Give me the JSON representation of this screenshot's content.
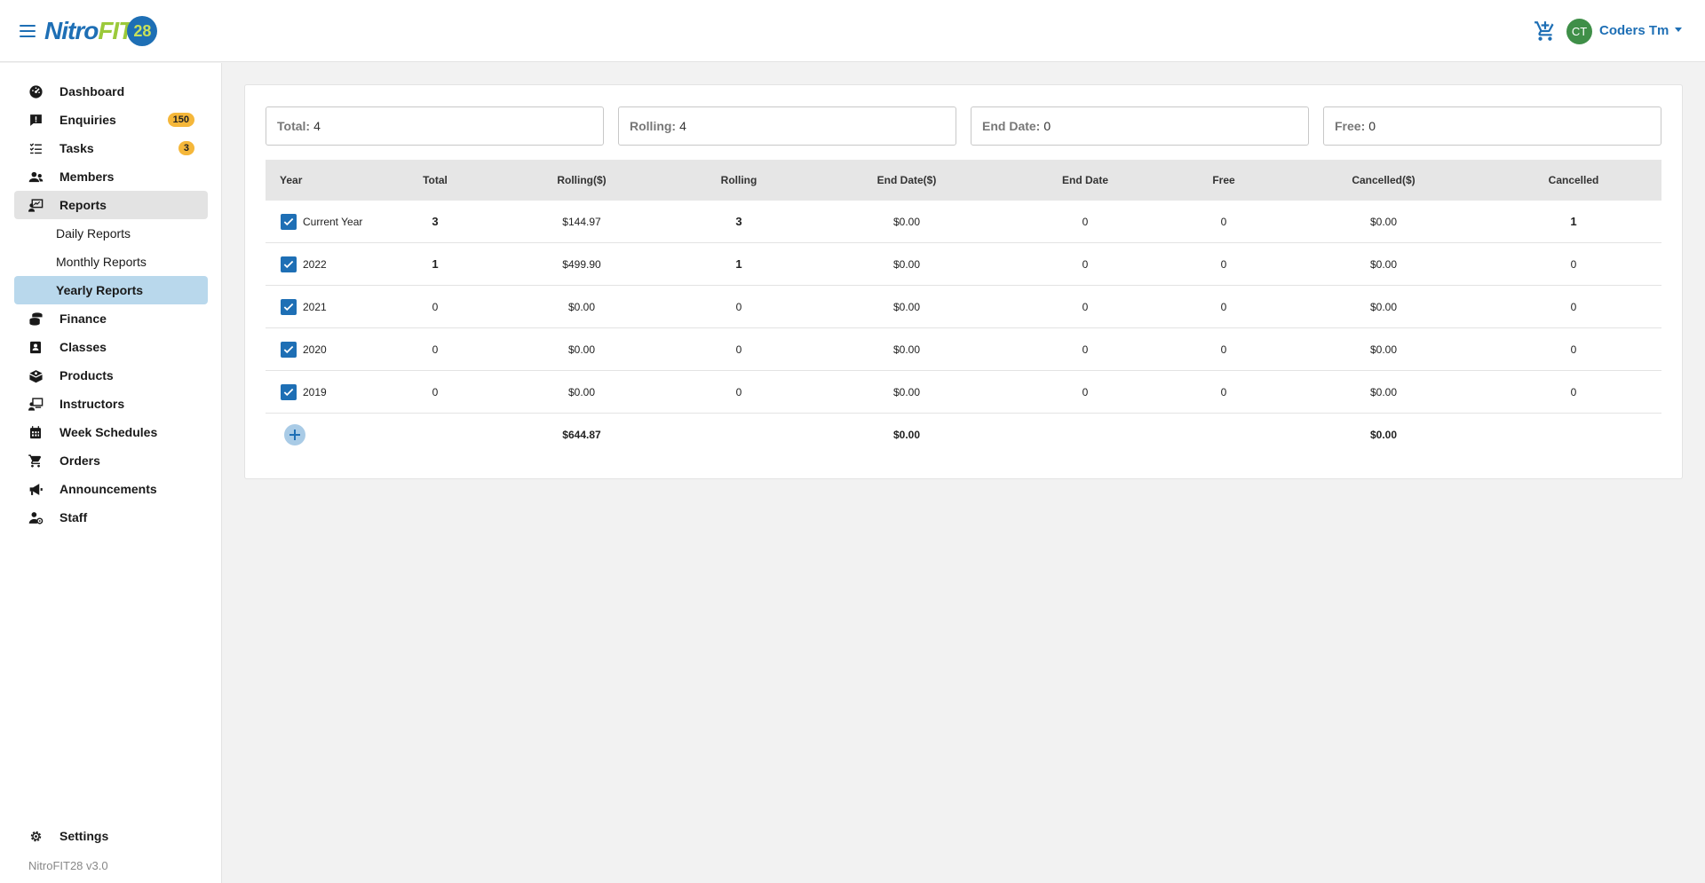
{
  "app": {
    "logo_part1": "Nitro",
    "logo_part2": "FIT",
    "logo_part3": "28",
    "version": "NitroFIT28 v3.0"
  },
  "user": {
    "initials": "CT",
    "name": "Coders Tm"
  },
  "sidebar": {
    "items": [
      {
        "label": "Dashboard",
        "icon": "dashboard-icon"
      },
      {
        "label": "Enquiries",
        "icon": "enquiries-icon",
        "badge": "150"
      },
      {
        "label": "Tasks",
        "icon": "tasks-icon",
        "badge": "3"
      },
      {
        "label": "Members",
        "icon": "members-icon"
      },
      {
        "label": "Reports",
        "icon": "reports-icon"
      },
      {
        "label": "Daily Reports"
      },
      {
        "label": "Monthly Reports"
      },
      {
        "label": "Yearly Reports"
      },
      {
        "label": "Finance",
        "icon": "finance-icon"
      },
      {
        "label": "Classes",
        "icon": "classes-icon"
      },
      {
        "label": "Products",
        "icon": "products-icon"
      },
      {
        "label": "Instructors",
        "icon": "instructors-icon"
      },
      {
        "label": "Week Schedules",
        "icon": "calendar-icon"
      },
      {
        "label": "Orders",
        "icon": "cart-icon"
      },
      {
        "label": "Announcements",
        "icon": "megaphone-icon"
      },
      {
        "label": "Staff",
        "icon": "staff-icon"
      }
    ],
    "settings_label": "Settings"
  },
  "stats": [
    {
      "key": "Total:",
      "value": "4"
    },
    {
      "key": "Rolling:",
      "value": "4"
    },
    {
      "key": "End Date:",
      "value": "0"
    },
    {
      "key": "Free:",
      "value": "0"
    }
  ],
  "table": {
    "headers": [
      "Year",
      "Total",
      "Rolling($)",
      "Rolling",
      "End Date($)",
      "End Date",
      "Free",
      "Cancelled($)",
      "Cancelled"
    ],
    "rows": [
      {
        "year": "Current Year",
        "total": "3",
        "rolling_usd": "$144.97",
        "rolling": "3",
        "end_date_usd": "$0.00",
        "end_date": "0",
        "free": "0",
        "cancelled_usd": "$0.00",
        "cancelled": "1"
      },
      {
        "year": "2022",
        "total": "1",
        "rolling_usd": "$499.90",
        "rolling": "1",
        "end_date_usd": "$0.00",
        "end_date": "0",
        "free": "0",
        "cancelled_usd": "$0.00",
        "cancelled": "0"
      },
      {
        "year": "2021",
        "total": "0",
        "rolling_usd": "$0.00",
        "rolling": "0",
        "end_date_usd": "$0.00",
        "end_date": "0",
        "free": "0",
        "cancelled_usd": "$0.00",
        "cancelled": "0"
      },
      {
        "year": "2020",
        "total": "0",
        "rolling_usd": "$0.00",
        "rolling": "0",
        "end_date_usd": "$0.00",
        "end_date": "0",
        "free": "0",
        "cancelled_usd": "$0.00",
        "cancelled": "0"
      },
      {
        "year": "2019",
        "total": "0",
        "rolling_usd": "$0.00",
        "rolling": "0",
        "end_date_usd": "$0.00",
        "end_date": "0",
        "free": "0",
        "cancelled_usd": "$0.00",
        "cancelled": "0"
      }
    ],
    "totals": {
      "rolling_usd": "$644.87",
      "end_date_usd": "$0.00",
      "cancelled_usd": "$0.00"
    }
  }
}
